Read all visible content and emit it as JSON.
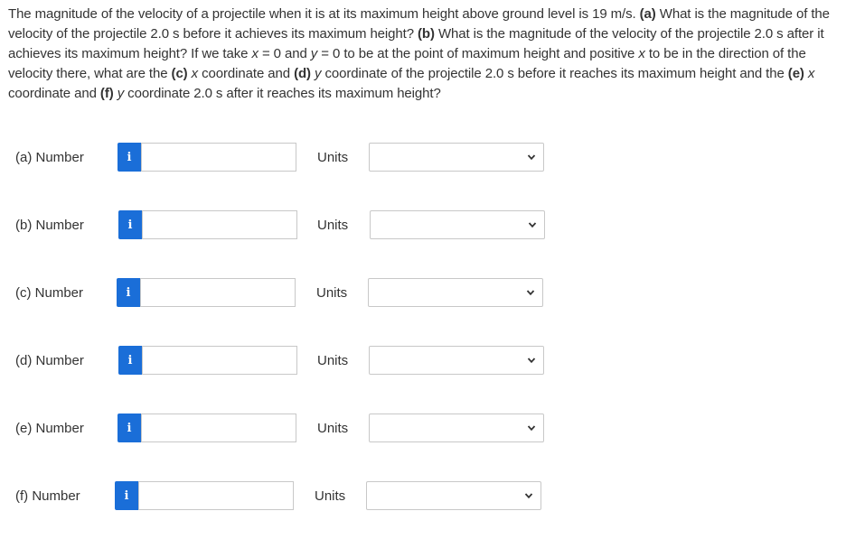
{
  "question": {
    "intro": "The magnitude of the velocity of a projectile when it is at its maximum height above ground level is 19 m/s.",
    "a_tag": "(a)",
    "a_text": "What is the magnitude of the velocity of the projectile 2.0 s before it achieves its maximum height?",
    "b_tag": "(b)",
    "b_text": "What is the magnitude of the velocity of the projectile 2.0 s after it achieves its maximum height? If we take",
    "x_var": "x",
    "x_eq": "= 0 and",
    "y_var": "y",
    "y_eq": "= 0 to be at the point of maximum height and positive",
    "x_var2": "x",
    "dir_text": "to be in the direction of the velocity there, what are the",
    "c_tag": "(c)",
    "c_var": "x",
    "c_text": "coordinate and",
    "d_tag": "(d)",
    "d_var": "y",
    "d_text": "coordinate of the projectile 2.0 s before it reaches its maximum height and the",
    "e_tag": "(e)",
    "e_var": "x",
    "e_text": "coordinate and",
    "f_tag": "(f)",
    "f_var": "y",
    "f_text": "coordinate 2.0 s after it reaches its maximum height?"
  },
  "info_glyph": "i",
  "info_icon": "info-icon",
  "select_icon": "chevron-down-icon",
  "accent_color": "#1a6ed8",
  "rows": [
    {
      "label": "(a)  Number",
      "number_value": "",
      "units_label": "Units",
      "units_value": ""
    },
    {
      "label": "(b)  Number",
      "number_value": "",
      "units_label": "Units",
      "units_value": ""
    },
    {
      "label": "(c)  Number",
      "number_value": "",
      "units_label": "Units",
      "units_value": ""
    },
    {
      "label": "(d)  Number",
      "number_value": "",
      "units_label": "Units",
      "units_value": ""
    },
    {
      "label": "(e)  Number",
      "number_value": "",
      "units_label": "Units",
      "units_value": ""
    },
    {
      "label": "(f)  Number",
      "number_value": "",
      "units_label": "Units",
      "units_value": ""
    }
  ]
}
